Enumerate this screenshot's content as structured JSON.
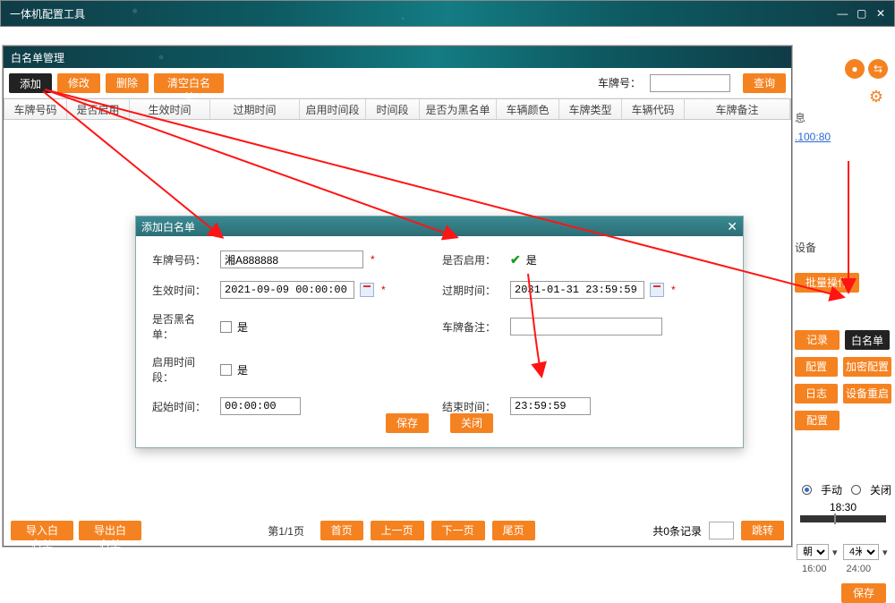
{
  "app_title": "一体机配置工具",
  "inner_window_title": "白名单管理",
  "toolbar": {
    "add": "添加",
    "edit": "修改",
    "delete": "删除",
    "clear": "清空白名单",
    "plate_label": "车牌号：",
    "query": "查询"
  },
  "grid_headers": [
    "车牌号码",
    "是否启用",
    "生效时间",
    "过期时间",
    "启用时间段",
    "时间段",
    "是否为黑名单",
    "车辆颜色",
    "车牌类型",
    "车辆代码",
    "车牌备注"
  ],
  "dialog": {
    "title": "添加白名单",
    "labels": {
      "plate": "车牌号码：",
      "effective": "生效时间：",
      "is_black": "是否黑名单：",
      "enable_period": "启用时间段：",
      "start": "起始时间：",
      "enabled": "是否启用：",
      "expire": "过期时间：",
      "remark": "车牌备注：",
      "end": "结束时间："
    },
    "values": {
      "plate": "湘A888888",
      "effective": "2021-09-09 00:00:00",
      "expire": "2031-01-31 23:59:59",
      "start": "00:00:00",
      "end": "23:59:59",
      "remark": ""
    },
    "checks": {
      "enabled_yes": "是",
      "black_yes": "是",
      "period_yes": "是"
    },
    "save": "保存",
    "close": "关闭"
  },
  "footer": {
    "import": "导入白名单",
    "export": "导出白名单",
    "page": "第1/1页",
    "first": "首页",
    "prev": "上一页",
    "next": "下一页",
    "last": "尾页",
    "total": "共0条记录",
    "jump": "跳转"
  },
  "right": {
    "section_info": "息",
    "ip": ".100:80",
    "device_label": "设备",
    "batch_op": "批量操作",
    "btns": {
      "record": "记录",
      "whitelist": "白名单",
      "config": "配置",
      "encrypt": "加密配置",
      "log": "日志",
      "reboot": "设备重启",
      "cfg2": "配置"
    },
    "radio_manual": "手动",
    "radio_close": "关闭",
    "time_val": "18:30",
    "distance": "4米",
    "t1": "16:00",
    "t2": "24:00",
    "save": "保存",
    "sel_suffix": "朝"
  },
  "chart_data": null
}
